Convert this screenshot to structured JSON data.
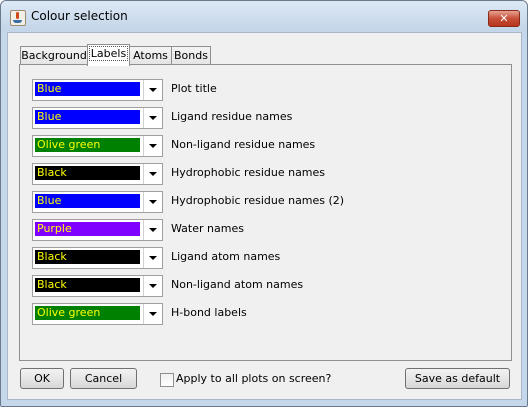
{
  "window": {
    "title": "Colour selection",
    "close_symbol": "✕"
  },
  "tabs": [
    {
      "label": "Background",
      "active": false
    },
    {
      "label": "Labels",
      "active": true
    },
    {
      "label": "Atoms",
      "active": false
    },
    {
      "label": "Bonds",
      "active": false
    }
  ],
  "rows": [
    {
      "colour": "Blue",
      "label": "Plot title",
      "fill": "#0000ff",
      "text_color": "#ffff00"
    },
    {
      "colour": "Blue",
      "label": "Ligand residue names",
      "fill": "#0000ff",
      "text_color": "#ffff00"
    },
    {
      "colour": "Olive green",
      "label": "Non-ligand residue names",
      "fill": "#008000",
      "text_color": "#ffff00"
    },
    {
      "colour": "Black",
      "label": "Hydrophobic residue names",
      "fill": "#000000",
      "text_color": "#ffff00"
    },
    {
      "colour": "Blue",
      "label": "Hydrophobic residue names (2)",
      "fill": "#0000ff",
      "text_color": "#ffff00"
    },
    {
      "colour": "Purple",
      "label": "Water names",
      "fill": "#8000ff",
      "text_color": "#ffff00"
    },
    {
      "colour": "Black",
      "label": "Ligand atom names",
      "fill": "#000000",
      "text_color": "#ffff00"
    },
    {
      "colour": "Black",
      "label": "Non-ligand atom names",
      "fill": "#000000",
      "text_color": "#ffff00"
    },
    {
      "colour": "Olive green",
      "label": "H-bond labels",
      "fill": "#008000",
      "text_color": "#ffff00"
    }
  ],
  "buttons": {
    "ok": "OK",
    "cancel": "Cancel",
    "save_default": "Save as default"
  },
  "apply_all": {
    "label": "Apply to all plots on screen?",
    "checked": false
  }
}
